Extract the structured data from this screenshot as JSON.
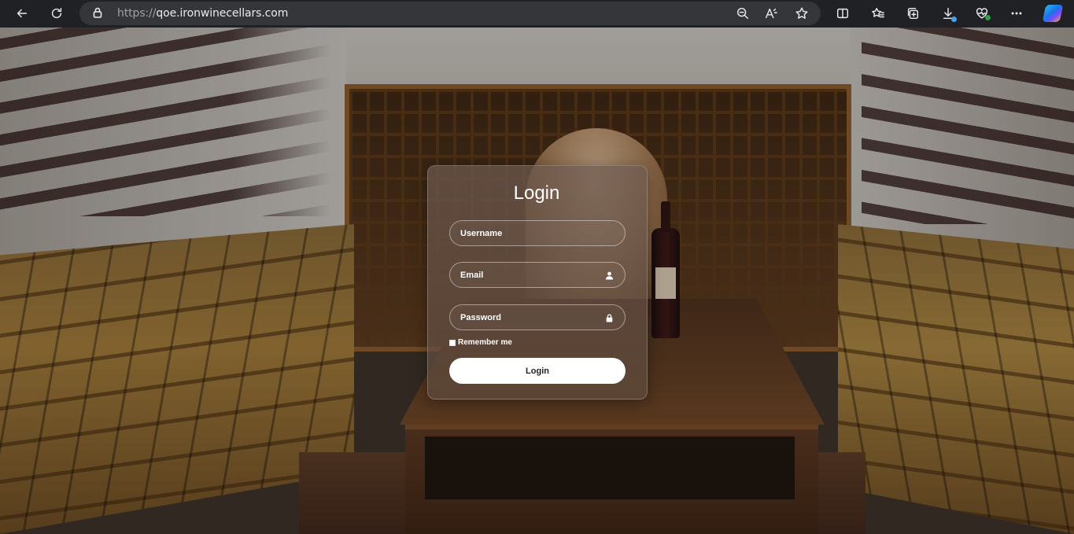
{
  "browser": {
    "url_scheme": "https://",
    "url_host": "qoe.ironwinecellars.com",
    "toolbar_icons": [
      "back-icon",
      "reload-icon",
      "lock-icon",
      "zoom-out-icon",
      "read-aloud-icon",
      "favorite-star-icon",
      "split-screen-icon",
      "favorites-icon",
      "collections-icon",
      "download-icon",
      "browser-essentials-icon",
      "more-icon",
      "copilot-icon"
    ]
  },
  "login": {
    "title": "Login",
    "username_placeholder": "Username",
    "email_placeholder": "Email",
    "password_placeholder": "Password",
    "remember_label": "Remember me",
    "submit_label": "Login"
  },
  "colors": {
    "card_tint": "#6e5a50",
    "button_bg": "#ffffff",
    "chrome_bg": "#202124"
  }
}
